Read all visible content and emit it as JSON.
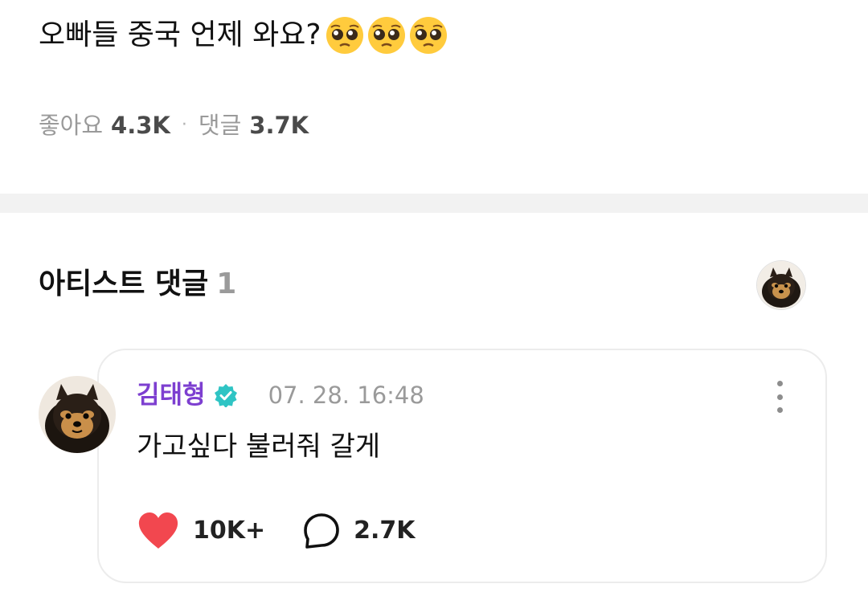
{
  "post": {
    "text": "오빠들 중국 언제 와요?",
    "emoji": [
      "pleading-face",
      "pleading-face",
      "pleading-face"
    ],
    "likes_label": "좋아요",
    "likes_count": "4.3K",
    "separator": "·",
    "comments_label": "댓글",
    "comments_count": "3.7K"
  },
  "artist_comments": {
    "title": "아티스트 댓글",
    "count": "1",
    "comment": {
      "author": "김태형",
      "verified": true,
      "timestamp": "07. 28. 16:48",
      "text": "가고싶다 불러줘 갈게",
      "likes": "10K+",
      "replies": "2.7K"
    }
  },
  "colors": {
    "author_name": "#7d3fd0",
    "verified_badge": "#2fc4c4",
    "heart": "#f2474f",
    "divider": "#f2f2f2",
    "muted_text": "#9a9a9a"
  }
}
